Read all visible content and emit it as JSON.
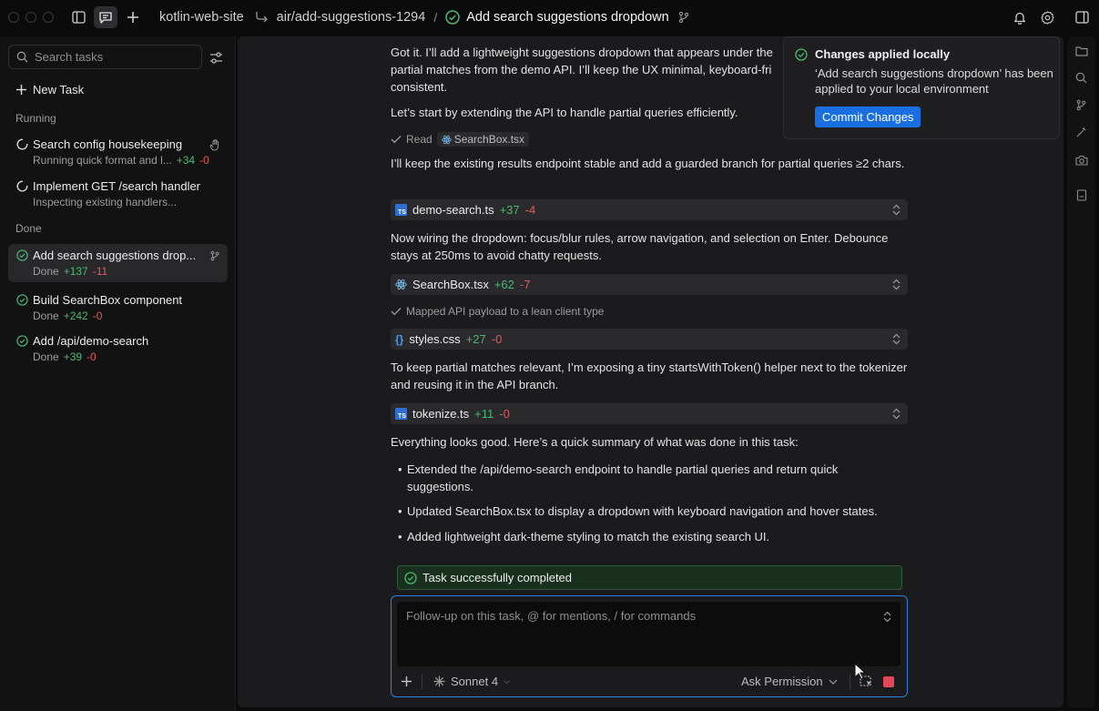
{
  "titlebar": {
    "repo": "kotlin-web-site",
    "sep": "/",
    "branch": "air/add-suggestions-1294",
    "task_title": "Add search suggestions dropdown"
  },
  "sidebar": {
    "search_placeholder": "Search tasks",
    "new_task": "New Task",
    "running_label": "Running",
    "done_label": "Done",
    "running": [
      {
        "name": "Search config housekeeping",
        "desc": "Running quick format and l...",
        "plus": "+34",
        "minus": "-0"
      },
      {
        "name": "Implement GET /search handler",
        "desc": "Inspecting existing handlers...",
        "plus": "",
        "minus": ""
      }
    ],
    "done": [
      {
        "name": "Add search suggestions drop...",
        "desc": "Done",
        "plus": "+137",
        "minus": "-11"
      },
      {
        "name": "Build SearchBox component",
        "desc": "Done",
        "plus": "+242",
        "minus": "-0"
      },
      {
        "name": "Add /api/demo-search",
        "desc": "Done",
        "plus": "+39",
        "minus": "-0"
      }
    ]
  },
  "chat": {
    "p1": "Got it. I’ll add a lightweight suggestions dropdown that appears under the partial matches from the demo API. I’ll keep the UX minimal, keyboard-fri consistent.",
    "p2": "Let’s start by extending the API to handle partial queries efficiently.",
    "read_label": "Read",
    "read_file": "SearchBox.tsx",
    "p3": "I’ll keep the existing results endpoint stable and add a guarded branch for partial queries ≥2 chars.",
    "file1": {
      "name": "demo-search.ts",
      "plus": "+37",
      "minus": "-4"
    },
    "p4": "Now wiring the dropdown: focus/blur rules, arrow navigation, and selection on Enter. Debounce stays at 250ms to avoid chatty requests.",
    "file2": {
      "name": "SearchBox.tsx",
      "plus": "+62",
      "minus": "-7"
    },
    "mapped": "Mapped API payload to a lean client type",
    "file3": {
      "name": "styles.css",
      "plus": "+27",
      "minus": "-0"
    },
    "p5": "To keep partial matches relevant, I’m exposing a tiny startsWithToken() helper next to the tokenizer and reusing it in the API branch.",
    "file4": {
      "name": "tokenize.ts",
      "plus": "+11",
      "minus": "-0"
    },
    "p6": "Everything looks good. Here’s a quick summary of what was done in this task:",
    "bullets": [
      "Extended the /api/demo-search endpoint to handle partial queries and return quick suggestions.",
      "Updated SearchBox.tsx to display a dropdown with keyboard navigation and hover states.",
      "Added lightweight dark-theme styling to match the existing search UI."
    ],
    "success": "Task successfully completed"
  },
  "composer": {
    "placeholder": "Follow-up on this task, @ for mentions, / for commands",
    "model": "Sonnet 4",
    "permission": "Ask Permission"
  },
  "toast": {
    "title": "Changes applied locally",
    "body": "‘Add search suggestions dropdown’ has been applied to your local environment",
    "button": "Commit Changes"
  },
  "colors": {
    "accent": "#1a6fe0",
    "added": "#4bb874",
    "removed": "#e0595b",
    "success_bg": "#18301d",
    "stop": "#e0485a"
  }
}
